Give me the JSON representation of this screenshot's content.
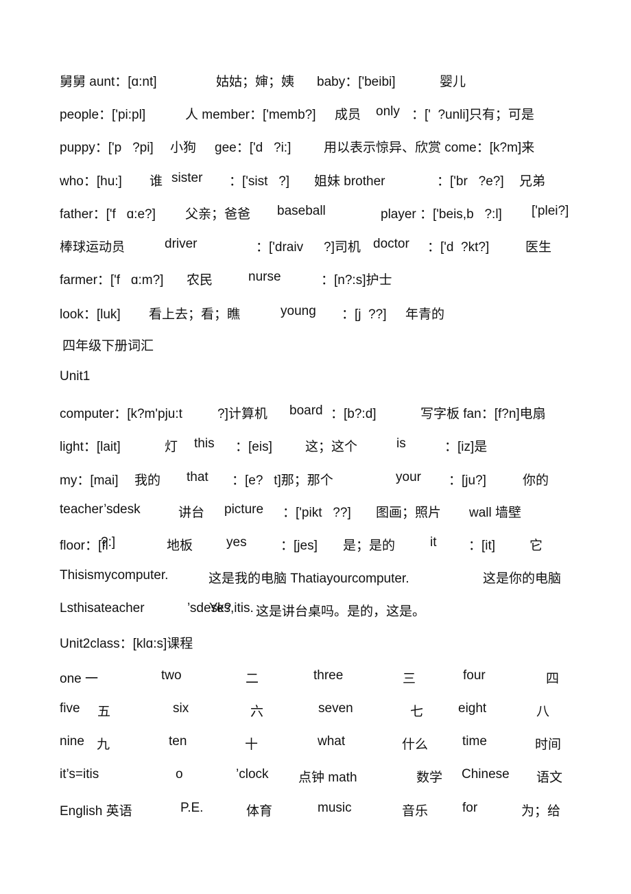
{
  "lines": [
    [
      "舅舅 aunt：[ɑ:nt]",
      "姑姑；婶；姨",
      "baby：['beibi]",
      "婴儿"
    ],
    [
      "people：['pi:pl]",
      "人 member：['memb?]",
      "成员",
      "only",
      "：['  ?unli]只有；可是"
    ],
    [
      "puppy：['p   ?pi]",
      "小狗",
      "gee：['d   ?i:]",
      "用以表示惊异、欣赏 come：[k?m]来"
    ],
    [
      "who：[hu:]",
      "谁",
      "sister",
      "：['sist   ?]",
      "姐妹 brother",
      "：['br   ?e?]",
      "兄弟"
    ],
    [
      "father：['f   ɑ:e?]",
      "父亲；爸爸",
      "baseball",
      "player ：['beis,b   ?:l]",
      "['plei?]"
    ],
    [
      "棒球运动员",
      "driver",
      "：['draiv",
      "?]司机",
      "doctor",
      "：['d  ?kt?]",
      "医生"
    ],
    [
      "farmer：['f   ɑ:m?]",
      "农民",
      "nurse",
      "：[n?:s]护士"
    ],
    [
      "look：[luk]",
      "看上去；看；瞧",
      "young",
      "：[j  ??]",
      "年青的"
    ],
    [
      "四年级下册词汇"
    ],
    [
      "Unit1"
    ],
    [
      "computer：[k?m'pju:t",
      "?]计算机",
      "board",
      "：[b?:d]",
      "写字板 fan：[f?n]电扇"
    ],
    [
      "light：[lait]",
      "灯",
      "this",
      "：[eis]",
      "这；这个",
      "is",
      "：[iz]是"
    ],
    [
      "my：[mai]",
      "我的",
      "that",
      "：[e?   t]那；那个",
      "your",
      "：[ju?]",
      "你的"
    ],
    [
      "teacher’sdesk",
      "讲台",
      "picture",
      "：['pikt   ??]",
      "图画；照片",
      "wall 墙壁"
    ],
    [
      "floor：[fl",
      "?:]",
      "地板",
      "yes",
      "：[jes]",
      "是；是的",
      "it",
      "：[it]",
      "它"
    ],
    [
      "Thisismycomputer.",
      "这是我的电脑 Thatiayourcomputer.",
      "这是你的电脑"
    ],
    [
      "Lsthisateacher",
      "’sdesk?",
      "Yes,itis.",
      "这是讲台桌吗。是的，这是。"
    ],
    [
      "Unit2class：[klɑ:s]课程"
    ],
    [
      "one 一",
      "two",
      "二",
      "three",
      "三",
      "four",
      "四"
    ],
    [
      "five",
      "五",
      "six",
      "六",
      "seven",
      "七",
      "eight",
      "八"
    ],
    [
      "nine",
      "九",
      "ten",
      "十",
      "what",
      "什么",
      "time",
      "时间"
    ],
    [
      "it’s=itis",
      "o",
      "’clock",
      "点钟 math",
      "数学",
      "Chinese",
      "语文"
    ],
    [
      "English 英语",
      "P.E.",
      "体育",
      "music",
      "音乐",
      "for",
      "为；给"
    ]
  ]
}
